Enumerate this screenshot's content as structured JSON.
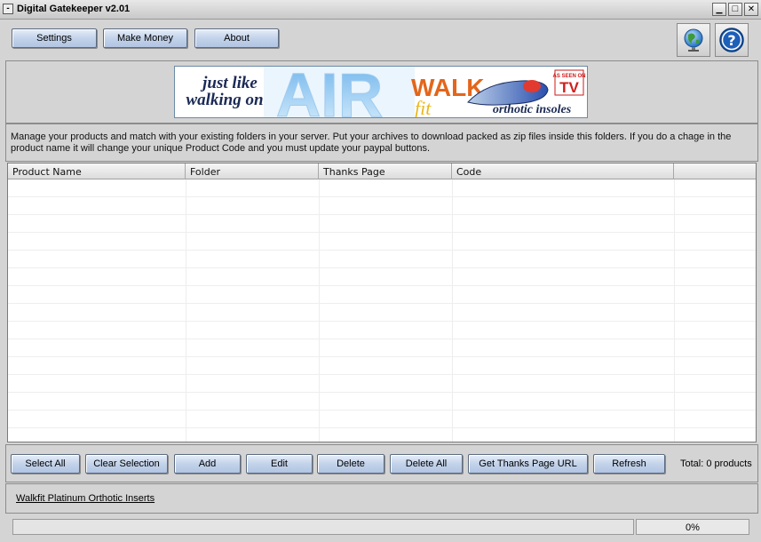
{
  "window": {
    "title": "Digital Gatekeeper v2.01",
    "minimize": "▁",
    "maximize": "□",
    "close": "✕"
  },
  "toolbar": {
    "settings": "Settings",
    "make_money": "Make Money",
    "about": "About"
  },
  "banner": {
    "line1": "just like",
    "line2": "walking on",
    "air": "AIR",
    "walk": "WALK",
    "fit": "fit",
    "tagline": "orthotic insoles",
    "seen_on": "AS SEEN ON",
    "tv": "TV"
  },
  "description": "Manage your products and match with your existing folders in your server. Put your archives to download packed as zip files inside this folders. If you do a chage in the product name it will change your unique Product Code and you must update your paypal buttons.",
  "table": {
    "columns": [
      "Product Name",
      "Folder",
      "Thanks Page",
      "Code"
    ],
    "rows": []
  },
  "actions": {
    "select_all": "Select All",
    "clear_selection": "Clear Selection",
    "add": "Add",
    "edit": "Edit",
    "delete": "Delete",
    "delete_all": "Delete All",
    "get_thanks_url": "Get Thanks Page URL",
    "refresh": "Refresh"
  },
  "total_label": "Total: 0 products",
  "footer_link": "Walkfit Platinum Orthotic Inserts",
  "progress": {
    "value": 0,
    "label": "0%"
  },
  "icons": {
    "globe": "globe-icon",
    "help": "help-icon"
  },
  "colors": {
    "button_top": "#e6eef9",
    "button_bottom": "#b1c4e2",
    "help_blue": "#1e5fb8",
    "tv_red": "#d21d1d",
    "walk_orange": "#e3661b"
  }
}
